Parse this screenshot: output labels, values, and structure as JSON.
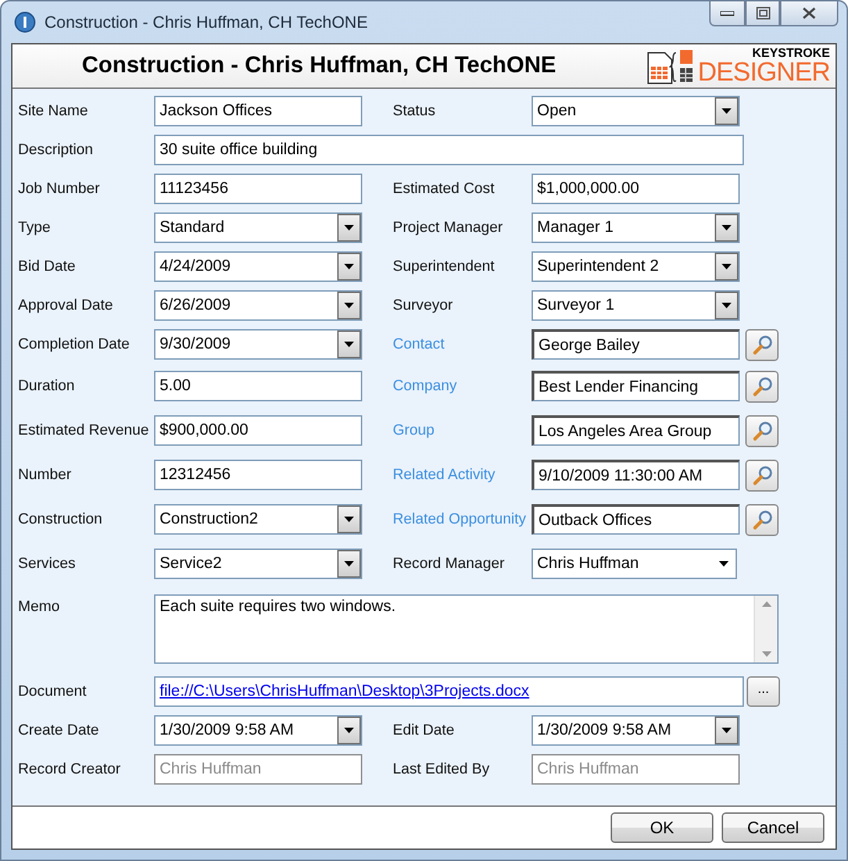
{
  "window": {
    "title": "Construction - Chris Huffman, CH TechONE"
  },
  "header": {
    "title": "Construction - Chris Huffman, CH TechONE"
  },
  "logo": {
    "top": "KEYSTROKE",
    "bottom": "DESIGNER"
  },
  "rows": [
    {
      "fields": [
        {
          "label": "Site Name",
          "kind": "text",
          "value": "Jackson Offices"
        },
        {
          "label": "Status",
          "kind": "dropdown",
          "value": "Open"
        }
      ]
    },
    {
      "fields": [
        {
          "label": "Description",
          "kind": "wide",
          "value": "30 suite office building"
        }
      ]
    },
    {
      "fields": [
        {
          "label": "Job Number",
          "kind": "text",
          "value": "11123456"
        },
        {
          "label": "Estimated Cost",
          "kind": "text",
          "value": "$1,000,000.00"
        }
      ]
    },
    {
      "fields": [
        {
          "label": "Type",
          "kind": "dropdown",
          "value": "Standard"
        },
        {
          "label": "Project Manager",
          "kind": "dropdown",
          "value": "Manager 1"
        }
      ]
    },
    {
      "fields": [
        {
          "label": "Bid Date",
          "kind": "dropdown",
          "value": "4/24/2009"
        },
        {
          "label": "Superintendent",
          "kind": "dropdown",
          "value": "Superintendent 2"
        }
      ]
    },
    {
      "fields": [
        {
          "label": "Approval Date",
          "kind": "dropdown",
          "value": "6/26/2009"
        },
        {
          "label": "Surveyor",
          "kind": "dropdown",
          "value": "Surveyor 1"
        }
      ]
    },
    {
      "fields": [
        {
          "label": "Completion Date",
          "kind": "dropdown",
          "value": "9/30/2009"
        },
        {
          "label": "Contact",
          "kind": "lookup",
          "value": "George Bailey"
        }
      ]
    },
    {
      "fields": [
        {
          "label": "Duration",
          "kind": "text",
          "value": "5.00"
        },
        {
          "label": "Company",
          "kind": "lookup",
          "value": "Best Lender Financing"
        }
      ]
    },
    {
      "fields": [
        {
          "label": "Estimated Revenue",
          "kind": "text",
          "value": "$900,000.00"
        },
        {
          "label": "Group",
          "kind": "lookup",
          "value": "Los Angeles Area Group"
        }
      ]
    },
    {
      "fields": [
        {
          "label": "Number",
          "kind": "text",
          "value": "12312456"
        },
        {
          "label": "Related Activity",
          "kind": "lookup",
          "value": "9/10/2009 11:30:00 AM"
        }
      ]
    },
    {
      "fields": [
        {
          "label": "Construction",
          "kind": "dropdown",
          "value": "Construction2"
        },
        {
          "label": "Related Opportunity",
          "kind": "lookup",
          "value": "Outback Offices"
        }
      ]
    },
    {
      "fields": [
        {
          "label": "Services",
          "kind": "dropdown",
          "value": "Service2"
        },
        {
          "label": "Record Manager",
          "kind": "combo",
          "value": "Chris Huffman"
        }
      ]
    },
    {
      "fields": [
        {
          "label": "Memo",
          "kind": "memo",
          "value": "Each suite requires two windows."
        }
      ]
    },
    {
      "fields": [
        {
          "label": "Document",
          "kind": "document",
          "value": "file://C:\\Users\\ChrisHuffman\\Desktop\\3Projects.docx",
          "button": "..."
        }
      ]
    },
    {
      "fields": [
        {
          "label": "Create Date",
          "kind": "dropdown",
          "value": "1/30/2009 9:58 AM"
        },
        {
          "label": "Edit Date",
          "kind": "dropdown",
          "value": "1/30/2009 9:58 AM"
        }
      ]
    },
    {
      "fields": [
        {
          "label": "Record Creator",
          "kind": "readonly",
          "value": "Chris Huffman"
        },
        {
          "label": "Last Edited By",
          "kind": "readonly",
          "value": "Chris Huffman"
        }
      ]
    }
  ],
  "buttons": [
    {
      "label": "OK"
    },
    {
      "label": "Cancel"
    }
  ]
}
